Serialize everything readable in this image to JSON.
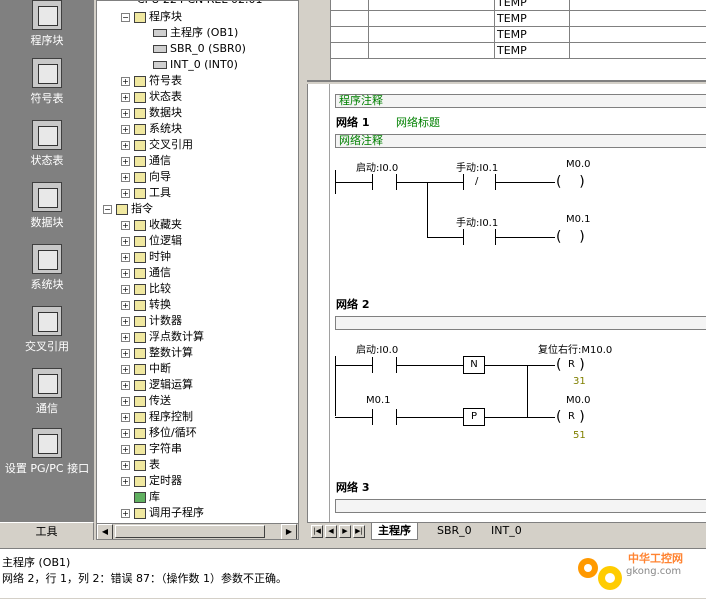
{
  "nav": {
    "items": [
      {
        "label": "程序块",
        "icon": "program-block-icon"
      },
      {
        "label": "符号表",
        "icon": "symbol-table-icon"
      },
      {
        "label": "状态表",
        "icon": "status-table-icon"
      },
      {
        "label": "数据块",
        "icon": "data-block-icon"
      },
      {
        "label": "系统块",
        "icon": "system-block-icon"
      },
      {
        "label": "交叉引用",
        "icon": "cross-reference-icon"
      },
      {
        "label": "通信",
        "icon": "communication-icon"
      },
      {
        "label": "设置 PG/PC 接口",
        "icon": "pgpc-interface-icon"
      }
    ],
    "footer": "工具"
  },
  "tree": {
    "top_cut": "CPU 224 CN REL 02.01",
    "program_block": "程序块",
    "program_children": [
      "主程序 (OB1)",
      "SBR_0 (SBR0)",
      "INT_0 (INT0)"
    ],
    "project_items": [
      "符号表",
      "状态表",
      "数据块",
      "系统块",
      "交叉引用",
      "通信",
      "向导",
      "工具"
    ],
    "instructions": "指令",
    "instruction_items": [
      "收藏夹",
      "位逻辑",
      "时钟",
      "通信",
      "比较",
      "转换",
      "计数器",
      "浮点数计算",
      "整数计算",
      "中断",
      "逻辑运算",
      "传送",
      "程序控制",
      "移位/循环",
      "字符串",
      "表",
      "定时器",
      "库",
      "调用子程序"
    ]
  },
  "var_table": {
    "rows": [
      "TEMP",
      "TEMP",
      "TEMP",
      "TEMP"
    ]
  },
  "editor": {
    "program_comment": "程序注释",
    "network1": {
      "title": "网络 1",
      "name": "网络标题",
      "comment": "网络注释",
      "contact_a": "启动:I0.0",
      "contact_b": "手动:I0.1",
      "contact_c": "手动:I0.1",
      "coil_a": "M0.0",
      "coil_b": "M0.1",
      "neg_sym": "/"
    },
    "network2": {
      "title": "网络 2",
      "contact_a": "启动:I0.0",
      "contact_b": "M0.1",
      "edge_n": "N",
      "edge_p": "P",
      "coil_a_label": "复位右行:M10.0",
      "coil_a": "R",
      "coil_a_num": "31",
      "coil_b_label": "M0.0",
      "coil_b": "R",
      "coil_b_num": "51"
    },
    "network3": {
      "title": "网络 3"
    }
  },
  "tabs": {
    "items": [
      "主程序",
      "SBR_0",
      "INT_0"
    ],
    "active": "主程序"
  },
  "status": {
    "line1": "主程序 (OB1)",
    "line2": "网络 2，行 1，列 2：错误 87：（操作数 1）参数不正确。"
  },
  "watermark": {
    "line1": "中华工控网",
    "line2": "gkong.com"
  }
}
